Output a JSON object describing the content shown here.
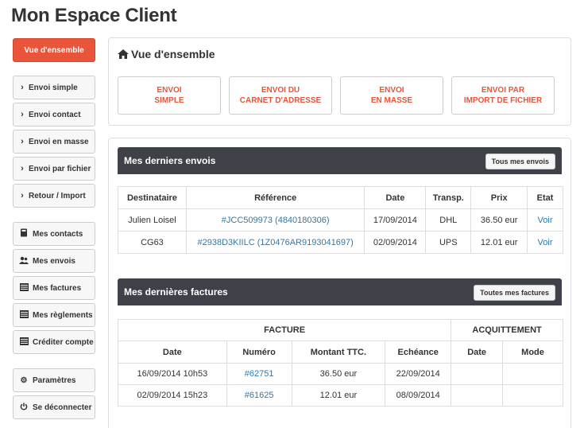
{
  "page": {
    "title": "Mon Espace Client"
  },
  "sidebar": {
    "active": "Vue d'ensemble",
    "group1": [
      "Envoi simple",
      "Envoi contact",
      "Envoi en masse",
      "Envoi par fichier",
      "Retour / Import"
    ],
    "group2": [
      {
        "label": "Mes contacts",
        "icon": "address-book-icon"
      },
      {
        "label": "Mes envois",
        "icon": "users-icon"
      },
      {
        "label": "Mes factures",
        "icon": "list-icon"
      },
      {
        "label": "Mes règlements",
        "icon": "list-icon"
      },
      {
        "label": "Créditer compte",
        "icon": "list-icon"
      }
    ],
    "group3": [
      {
        "label": "Paramètres",
        "icon": "gear-icon"
      },
      {
        "label": "Se déconnecter",
        "icon": "power-icon"
      }
    ]
  },
  "overview": {
    "title": "Vue d'ensemble",
    "buttons": [
      [
        "ENVOI",
        "SIMPLE"
      ],
      [
        "ENVOI DU",
        "CARNET D'ADRESSE"
      ],
      [
        "ENVOI",
        "EN MASSE"
      ],
      [
        "ENVOI PAR",
        "IMPORT DE FICHIER"
      ]
    ]
  },
  "envois": {
    "title": "Mes derniers envois",
    "all_button": "Tous mes envois",
    "columns": [
      "Destinataire",
      "Référence",
      "Date",
      "Transp.",
      "Prix",
      "Etat"
    ],
    "rows": [
      [
        "Julien Loisel",
        "#JCC509973 (4840180306)",
        "17/09/2014",
        "DHL",
        "36.50 eur",
        "Voir"
      ],
      [
        "CG63",
        "#2938D3KIILC (1Z0476AR9193041697)",
        "02/09/2014",
        "UPS",
        "12.01 eur",
        "Voir"
      ]
    ]
  },
  "factures": {
    "title": "Mes dernières factures",
    "all_button": "Toutes mes factures",
    "group_headers": [
      "FACTURE",
      "ACQUITTEMENT"
    ],
    "columns": [
      "Date",
      "Numéro",
      "Montant TTC.",
      "Echéance",
      "Date",
      "Mode"
    ],
    "rows": [
      [
        "16/09/2014 10h53",
        "#62751",
        "36.50 eur",
        "22/09/2014",
        "",
        ""
      ],
      [
        "02/09/2014 15h23",
        "#61625",
        "12.01 eur",
        "08/09/2014",
        "",
        ""
      ]
    ]
  },
  "colors": {
    "accent": "#e8553a",
    "dark_bar": "#3e4248",
    "link": "#2a7ab0"
  }
}
